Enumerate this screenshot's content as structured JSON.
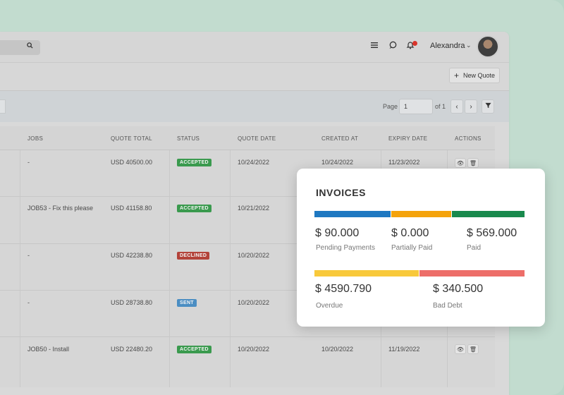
{
  "header": {
    "user_name": "Alexandra",
    "icons": [
      "menu-icon",
      "chat-icon",
      "bell-icon",
      "search-icon"
    ]
  },
  "toolbar": {
    "new_quote_label": "New Quote",
    "new_quote_icon": "+"
  },
  "pager": {
    "page_label": "Page",
    "page_value": "1",
    "of_label": "of 1",
    "prev": "‹",
    "next": "›",
    "filter_icon": "filter-icon"
  },
  "table": {
    "headers": [
      "JOBS",
      "QUOTE TOTAL",
      "STATUS",
      "QUOTE DATE",
      "CREATED AT",
      "EXPIRY DATE",
      "ACTIONS"
    ],
    "rows": [
      {
        "job": "-",
        "total": "USD 40500.00",
        "status": "ACCEPTED",
        "status_color": "#3a9a4e",
        "quote_date": "10/24/2022",
        "created_at": "10/24/2022",
        "expiry": "11/23/2022"
      },
      {
        "job": "JOB53 - Fix this please",
        "total": "USD 41158.80",
        "status": "ACCEPTED",
        "status_color": "#3a9a4e",
        "quote_date": "10/21/2022",
        "created_at": "",
        "expiry": ""
      },
      {
        "job": "-",
        "total": "USD 42238.80",
        "status": "DECLINED",
        "status_color": "#b3433a",
        "quote_date": "10/20/2022",
        "created_at": "",
        "expiry": ""
      },
      {
        "job": "-",
        "total": "USD 28738.80",
        "status": "SENT",
        "status_color": "#4b8ec3",
        "quote_date": "10/20/2022",
        "created_at": "",
        "expiry": ""
      },
      {
        "job": "JOB50 - Install",
        "total": "USD 22480.20",
        "status": "ACCEPTED",
        "status_color": "#3a9a4e",
        "quote_date": "10/20/2022",
        "created_at": "10/20/2022",
        "expiry": "11/19/2022"
      }
    ],
    "action_icons": [
      "eye-icon",
      "trash-icon"
    ]
  },
  "invoices": {
    "title": "INVOICES",
    "top_bar_colors": [
      "#1f78c1",
      "#f4a30c",
      "#198a4d"
    ],
    "bottom_bar_colors": [
      "#f8c93b",
      "#ed6e69"
    ],
    "items": [
      {
        "amount": "$ 90.000",
        "label": "Pending Payments"
      },
      {
        "amount": "$ 0.000",
        "label": "Partially Paid"
      },
      {
        "amount": "$ 569.000",
        "label": "Paid"
      },
      {
        "amount": "$ 4590.790",
        "label": "Overdue"
      },
      {
        "amount": "$ 340.500",
        "label": "Bad Debt"
      }
    ]
  }
}
